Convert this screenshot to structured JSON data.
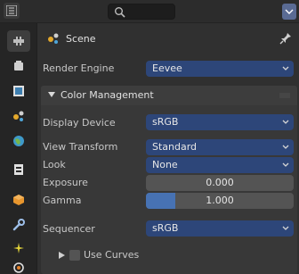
{
  "header": {
    "editor_icon": "properties-editor-icon",
    "search_icon": "search-icon",
    "dropdown_icon": "chevron-down-icon"
  },
  "tabs": [
    {
      "name": "tool-tab",
      "icon": "tool-icon",
      "active": true
    },
    {
      "name": "render-tab",
      "icon": "render-icon",
      "active": false
    },
    {
      "name": "output-tab",
      "icon": "output-icon",
      "active": false
    },
    {
      "name": "scene-tab",
      "icon": "scene-icon",
      "active": false
    },
    {
      "name": "world-tab",
      "icon": "world-icon",
      "active": false
    },
    {
      "name": "collection-tab",
      "icon": "collection-icon",
      "active": false
    },
    {
      "name": "object-tab",
      "icon": "object-icon",
      "active": false
    },
    {
      "name": "modifier-tab",
      "icon": "wrench-icon",
      "active": false
    },
    {
      "name": "particles-tab",
      "icon": "particles-icon",
      "active": false
    },
    {
      "name": "physics-tab",
      "icon": "physics-icon",
      "active": false
    }
  ],
  "scene": {
    "title": "Scene",
    "pin_icon": "pin-icon"
  },
  "render_engine": {
    "label": "Render Engine",
    "value": "Eevee"
  },
  "color_management": {
    "title": "Color Management",
    "display_device": {
      "label": "Display Device",
      "value": "sRGB"
    },
    "view_transform": {
      "label": "View Transform",
      "value": "Standard"
    },
    "look": {
      "label": "Look",
      "value": "None"
    },
    "exposure": {
      "label": "Exposure",
      "value": "0.000",
      "fraction": 0.0
    },
    "gamma": {
      "label": "Gamma",
      "value": "1.000",
      "fraction": 0.2
    },
    "sequencer": {
      "label": "Sequencer",
      "value": "sRGB"
    },
    "use_curves": {
      "label": "Use Curves",
      "checked": false
    }
  },
  "colors": {
    "accent_blue": "#4772b3",
    "dropdown_blue": "#2d4679",
    "panel_bg": "#383838"
  }
}
